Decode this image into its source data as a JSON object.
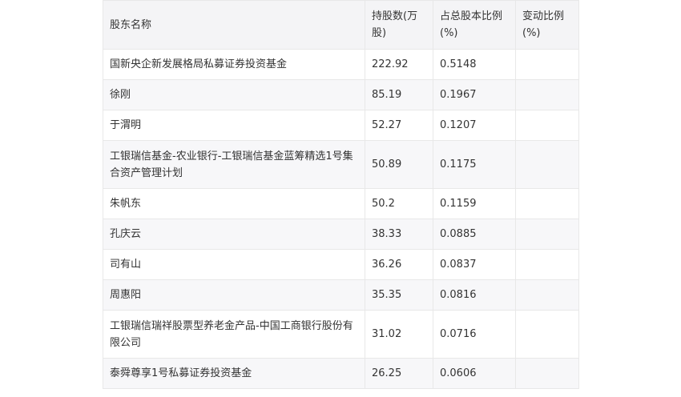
{
  "table": {
    "headers": [
      "股东名称",
      "持股数(万股)",
      "占总股本比例(%)",
      "变动比例(%)"
    ],
    "rows": [
      {
        "name": "国新央企新发展格局私募证券投资基金",
        "shares": "222.92",
        "ratio": "0.5148",
        "change": ""
      },
      {
        "name": "徐刚",
        "shares": "85.19",
        "ratio": "0.1967",
        "change": ""
      },
      {
        "name": "于渭明",
        "shares": "52.27",
        "ratio": "0.1207",
        "change": ""
      },
      {
        "name": "工银瑞信基金-农业银行-工银瑞信基金蓝筹精选1号集合资产管理计划",
        "shares": "50.89",
        "ratio": "0.1175",
        "change": ""
      },
      {
        "name": "朱帆东",
        "shares": "50.2",
        "ratio": "0.1159",
        "change": ""
      },
      {
        "name": "孔庆云",
        "shares": "38.33",
        "ratio": "0.0885",
        "change": ""
      },
      {
        "name": "司有山",
        "shares": "36.26",
        "ratio": "0.0837",
        "change": ""
      },
      {
        "name": "周惠阳",
        "shares": "35.35",
        "ratio": "0.0816",
        "change": ""
      },
      {
        "name": "工银瑞信瑞祥股票型养老金产品-中国工商银行股份有限公司",
        "shares": "31.02",
        "ratio": "0.0716",
        "change": ""
      },
      {
        "name": "泰舜尊享1号私募证券投资基金",
        "shares": "26.25",
        "ratio": "0.0606",
        "change": ""
      }
    ]
  }
}
